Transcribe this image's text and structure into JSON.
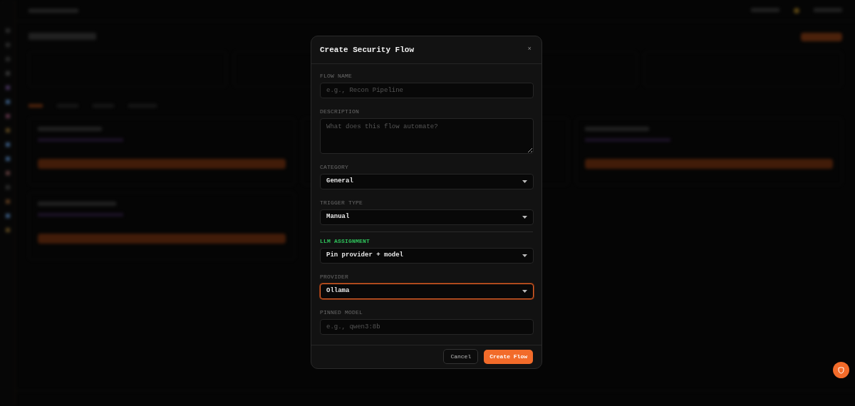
{
  "dialog": {
    "title": "Create Security Flow",
    "close": "×",
    "fields": [
      {
        "kind": "input",
        "label": "FLOW NAME",
        "placeholder": "e.g., Recon Pipeline",
        "heading": false,
        "focused": false
      },
      {
        "kind": "textarea",
        "label": "DESCRIPTION",
        "placeholder": "What does this flow automate?",
        "heading": false,
        "focused": false
      },
      {
        "kind": "select",
        "label": "CATEGORY",
        "value": "General",
        "heading": false,
        "focused": false
      },
      {
        "kind": "select",
        "label": "TRIGGER TYPE",
        "value": "Manual",
        "heading": false,
        "focused": false
      },
      {
        "kind": "select",
        "label": "LLM ASSIGNMENT",
        "value": "Pin provider + model",
        "heading": true,
        "focused": false
      },
      {
        "kind": "select",
        "label": "PROVIDER",
        "value": "Ollama",
        "heading": false,
        "focused": true
      },
      {
        "kind": "input",
        "label": "PINNED MODEL",
        "placeholder": "e.g., qwen3:8b",
        "heading": false,
        "focused": false
      }
    ],
    "buttons": [
      {
        "label": "Cancel",
        "kind": "secondary"
      },
      {
        "label": "Create Flow",
        "kind": "primary"
      }
    ]
  }
}
